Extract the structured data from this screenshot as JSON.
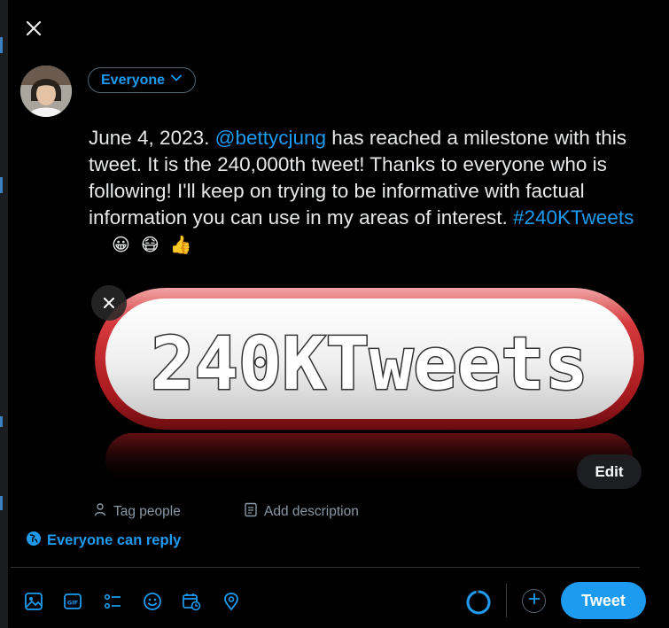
{
  "composer": {
    "audience_label": "Everyone",
    "tweet_text": {
      "before_mention": "June 4, 2023. ",
      "mention": "@bettycjung",
      "after_mention": " has reached a milestone with this tweet. It is the 240,000th tweet! Thanks to everyone who is following! I'll keep on trying to be informative with factual information you can use in my areas of interest.  ",
      "hashtag": "#240KTweets",
      "emojis": [
        "😀",
        "😷",
        "👍"
      ]
    },
    "media": {
      "image_text": "240KTweets",
      "edit_label": "Edit",
      "tag_people_label": "Tag people",
      "add_description_label": "Add description"
    },
    "reply_setting_label": "Everyone can reply",
    "toolbar": {
      "icons": [
        "image-icon",
        "gif-icon",
        "poll-icon",
        "emoji-icon",
        "schedule-icon",
        "location-icon"
      ],
      "tweet_button_label": "Tweet"
    },
    "colors": {
      "accent": "#1d9bf0",
      "background": "#000000",
      "text": "#e7e9ea",
      "muted": "#8b98a5",
      "pill_red": "#c8252a"
    }
  }
}
